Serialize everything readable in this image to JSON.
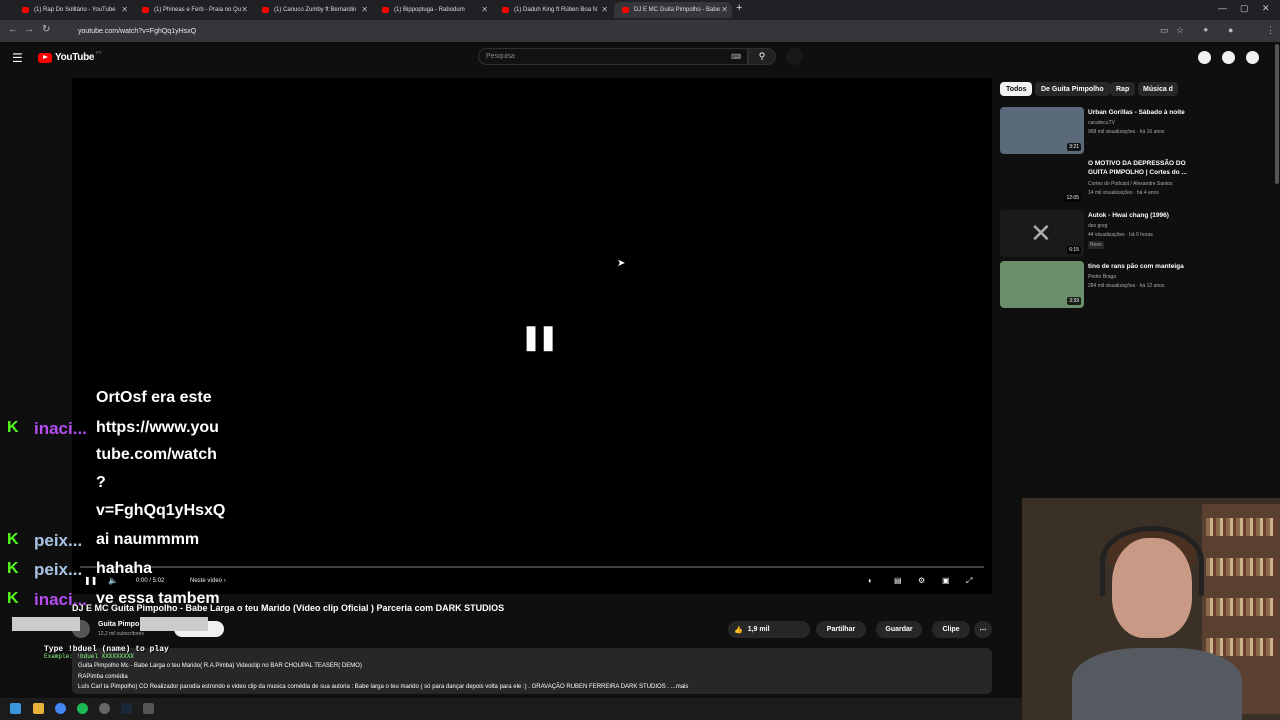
{
  "browser": {
    "tabs": [
      {
        "title": "(1) Rap Do Solitário - YouTube",
        "active": false
      },
      {
        "title": "(1) Phineas e Ferb - Praia no Qu",
        "active": false
      },
      {
        "title": "(1) Canuco Zumby ft Bernardin",
        "active": false
      },
      {
        "title": "(1) Bippoptuga - Rabodum",
        "active": false
      },
      {
        "title": "(1) Daduh King ft Rúben Boa N",
        "active": false
      },
      {
        "title": "DJ E MC Guita Pimpolho - Babe",
        "active": true
      }
    ],
    "url": "youtube.com/watch?v=FghQq1yHsxQ"
  },
  "masthead": {
    "logo_text": "YouTube",
    "country_code": "PT",
    "search_placeholder": "Pesquisa"
  },
  "player": {
    "time": "0:00 / 5:02",
    "next_label": "Neste vídeo",
    "state": "paused"
  },
  "chat": {
    "lines": [
      {
        "user": "inaci...",
        "user_color": "#b44cf0",
        "message": "OrtOsf era este\nhttps://www.you\ntube.com/watch\n?\nv=FghQq1yHsxQ"
      },
      {
        "user": "peix...",
        "user_color": "#a9c4e6",
        "message": "ai naummmm"
      },
      {
        "user": "peix...",
        "user_color": "#a9c4e6",
        "message": "hahaha"
      },
      {
        "user": "inaci...",
        "user_color": "#b44cf0",
        "message": "ve essa tambem"
      }
    ],
    "msg_lines": [
      "OrtOsf era este",
      "https://www.you",
      "tube.com/watch",
      "?",
      "v=FghQq1yHsxQ",
      "ai naummmm",
      "hahaha",
      "ve essa tambem"
    ]
  },
  "video": {
    "title": "DJ E MC Guita Pimpolho - Babe Larga o teu Marido (Vídeo clip Oficial ) Parceria com DARK STUDIOS",
    "channel": "Guita Pimpo",
    "subscribers": "12,2 mil subscritores",
    "likes": "1,9 mil",
    "share_label": "Partilhar",
    "save_label": "Guardar",
    "clip_label": "Clipe",
    "description_lines": [
      "Guita Pimpolho Mc - Babe Larga o teu Marido( R.A.Pimba) Videoclip no BAR CHOUPAL TEASER( DEMO)",
      "RAPimba comédia",
      "Luís Carl ta Pimpolho) CO Realizador parodia estrondo e video clip da musica comédia de sua autoria : Babe larga o teu marido ( só para dançar depois volta para ele :) . GRAVAÇÃO RUBEN FERREIRA DARK STUDIOS . ...mais"
    ]
  },
  "overlay": {
    "command_line": "Type !bduel (name) to play",
    "command_example": "Example: !bduel XXXXXXXXX"
  },
  "sidebar": {
    "chips": [
      {
        "label": "Todos",
        "active": true
      },
      {
        "label": "De Guita Pimpolho",
        "active": false
      },
      {
        "label": "Rap",
        "active": false
      },
      {
        "label": "Música d",
        "active": false
      }
    ],
    "recommendations": [
      {
        "title": "Urban Gorillas - Sábado à noite",
        "channel": "caradecuTV",
        "meta": "968 mil visualizações · há 16 anos",
        "duration": "3:21",
        "badge": ""
      },
      {
        "title": "O MOTIVO DA DEPRESSÃO DO GUITA PIMPOLHO | Cortes do ...",
        "channel": "Cortes do Podcast / Alexandre Santos",
        "meta": "14 mil visualizações · há 4 anos",
        "duration": "12:05",
        "badge": ""
      },
      {
        "title": "Autok - Hwai chang (1996)",
        "channel": "des greg",
        "meta": "44 visualizações · há 6 horas",
        "duration": "6:15",
        "badge": "Novo"
      },
      {
        "title": "tino de rans pão com manteiga",
        "channel": "Pedro Braga",
        "meta": "284 mil visualizações · há 12 anos",
        "duration": "3:39",
        "badge": ""
      }
    ]
  },
  "colors": {
    "bg": "#0f0f0f",
    "yt_red": "#ff0000",
    "kick_green": "#53fc18"
  }
}
